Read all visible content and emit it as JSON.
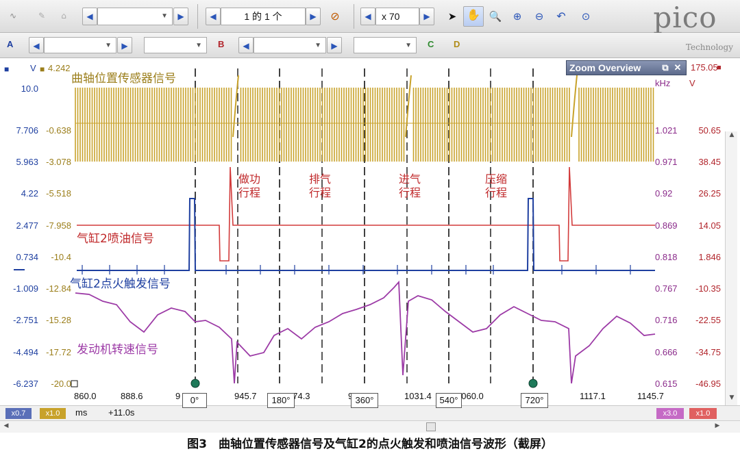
{
  "toolbar": {
    "page_indicator": "1 的 1 个",
    "zoom_value": "x 70",
    "logo_text": "pico",
    "logo_subtext": "Technology"
  },
  "channels": {
    "A": "A",
    "B": "B",
    "C": "C",
    "D": "D"
  },
  "axes": {
    "left_a_unit": "V",
    "left_b_top": "4.242",
    "left_a": [
      "10.0",
      "7.706",
      "5.963",
      "4.22",
      "2.477",
      "0.734",
      "-1.009",
      "-2.751",
      "-4.494",
      "-6.237"
    ],
    "left_b": [
      "-0.638",
      "-3.078",
      "-5.518",
      "-7.958",
      "-10.4",
      "-12.84",
      "-15.28",
      "-17.72",
      "-20.0"
    ],
    "right_c_unit": "kHz",
    "right_d_unit": "V",
    "right_d_top": "175.05",
    "right_c": [
      "1.021",
      "0.971",
      "0.92",
      "0.869",
      "0.818",
      "0.767",
      "0.716",
      "0.666",
      "0.615"
    ],
    "right_d": [
      "50.65",
      "38.45",
      "26.25",
      "14.05",
      "1.846",
      "-10.35",
      "-22.55",
      "-34.75",
      "-46.95"
    ]
  },
  "traces": {
    "crank_sensor": "曲轴位置传感器信号",
    "injector": "气缸2喷油信号",
    "ignition": "气缸2点火触发信号",
    "engine_speed": "发动机转速信号"
  },
  "strokes": [
    {
      "line1": "做功",
      "line2": "行程"
    },
    {
      "line1": "排气",
      "line2": "行程"
    },
    {
      "line1": "进气",
      "line2": "行程"
    },
    {
      "line1": "压缩",
      "line2": "行程"
    }
  ],
  "x_axis": {
    "ticks": [
      "860.0",
      "888.6",
      "9",
      "945.7",
      "974.3",
      "9",
      "1031.4",
      "1060.0",
      "6",
      "1117.1",
      "1145.7"
    ],
    "angles": [
      "0°",
      "180°",
      "360°",
      "540°",
      "720°"
    ]
  },
  "zoom_overview": {
    "title": "Zoom Overview"
  },
  "status": {
    "chip_a": "x0.7",
    "chip_b": "x1.0",
    "unit": "ms",
    "offset": "+11.0s",
    "chip_c": "x3.0",
    "chip_d": "x1.0"
  },
  "caption": "图3　曲轴位置传感器信号及气缸2的点火触发和喷油信号波形（截屏）",
  "colors": {
    "channel_a": "#1e3fa0",
    "channel_b": "#c8a22a",
    "channel_c": "#9c3aa6",
    "channel_d": "#d23a3a"
  }
}
